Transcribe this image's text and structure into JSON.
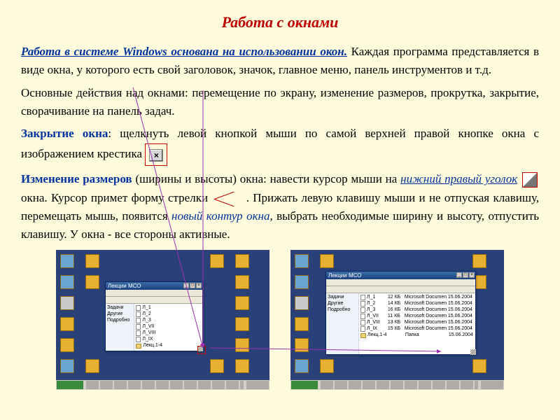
{
  "title": "Работа с окнами",
  "p1_lead": "Работа в системе Windows основана на использовании окон.",
  "p1_rest": " Каждая программа представляется в виде окна, у которого есть свой заголовок, значок, главное меню, панель инструментов и т.д.",
  "p2": "Основные действия над окнами: перемещение по экрану, изменение размеров, прокрутка, закрытие, сворачивание на панель задач.",
  "p3_label": "Закрытие окна",
  "p3_rest": ": щелкнуть левой кнопкой мыши по самой верхней правой кнопке окна с изображением крестика ",
  "close_symbol": "×",
  "p4_label": "Изменение размеров",
  "p4_a": " (ширины и высоты) окна: навести курсор мыши на ",
  "p4_corner": "нижний правый уголок",
  "p4_b": " окна. Курсор примет форму стрелки ",
  "p4_c": " . Прижать левую клавишу мыши и не отпуская клавишу, перемещать мышь, появится ",
  "p4_contour": "новый контур окна",
  "p4_d": ",  выбрать необходимые ширину и высоту, отпустить клавишу. У окна - все стороны активные.",
  "win_title": "Лекции МСО",
  "files_small": [
    "Л_1",
    "Л_2",
    "Л_3",
    "Л_VII",
    "Л_VIII",
    "Л_IX",
    "Лекц.1-4"
  ],
  "files_detail": [
    {
      "name": "Л_1",
      "size": "12 КБ",
      "type": "Microsoft Document",
      "date": "15.06.2004"
    },
    {
      "name": "Л_2",
      "size": "14 КБ",
      "type": "Microsoft Document",
      "date": "15.06.2004"
    },
    {
      "name": "Л_3",
      "size": "16 КБ",
      "type": "Microsoft Document",
      "date": "15.06.2004"
    },
    {
      "name": "Л_VII",
      "size": "11 КБ",
      "type": "Microsoft Document",
      "date": "15.06.2004"
    },
    {
      "name": "Л_VIII",
      "size": "13 КБ",
      "type": "Microsoft Document",
      "date": "15.06.2004"
    },
    {
      "name": "Л_IX",
      "size": "15 КБ",
      "type": "Microsoft Document",
      "date": "15.06.2004"
    },
    {
      "name": "Лекц.1-4",
      "size": "",
      "type": "Папка",
      "date": "15.06.2004"
    }
  ],
  "side_links": [
    "Задачи",
    "Другие",
    "Подробно"
  ]
}
